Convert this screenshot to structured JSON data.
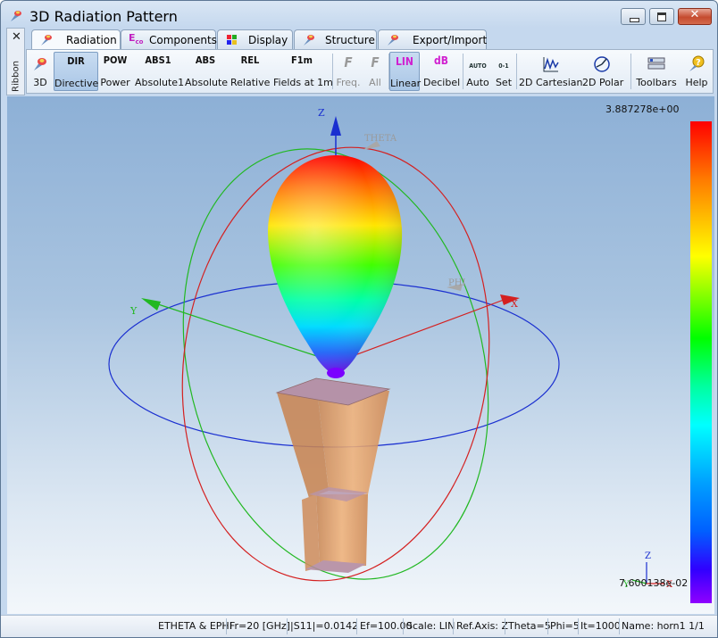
{
  "window": {
    "title": "3D Radiation Pattern"
  },
  "ribbon": {
    "close_glyph": "✕",
    "side_label": "Ribbon"
  },
  "tabs": [
    {
      "label": "Radiation",
      "icon": "radiation-tab-icon"
    },
    {
      "label": "Components",
      "icon": "eco-components-icon"
    },
    {
      "label": "Display",
      "icon": "display-tab-icon"
    },
    {
      "label": "Structure",
      "icon": "structure-tab-icon"
    },
    {
      "label": "Export/Import",
      "icon": "export-import-icon"
    }
  ],
  "toolbar": {
    "btn_3d": {
      "label": "3D"
    },
    "btn_directive": {
      "icon": "DIR",
      "label": "Directive"
    },
    "btn_power": {
      "icon": "POW",
      "label": "Power"
    },
    "btn_absolute1": {
      "icon": "ABS1",
      "label": "Absolute1"
    },
    "btn_absolute": {
      "icon": "ABS",
      "label": "Absolute"
    },
    "btn_relative": {
      "icon": "REL",
      "label": "Relative"
    },
    "btn_fields": {
      "icon": "F1m",
      "label": "Fields at 1m"
    },
    "btn_freq": {
      "icon": "F",
      "label": "Freq."
    },
    "btn_all": {
      "icon": "F",
      "label": "All"
    },
    "btn_linear": {
      "icon": "LIN",
      "label": "Linear"
    },
    "btn_decibel": {
      "icon": "dB",
      "label": "Decibel"
    },
    "btn_auto": {
      "icon": "AUTO",
      "label": "Auto"
    },
    "btn_set": {
      "icon": "0-1",
      "label": "Set"
    },
    "btn_2d_cartesian": {
      "label": "2D Cartesian"
    },
    "btn_2d_polar": {
      "label": "2D Polar"
    },
    "btn_toolbars": {
      "label": "Toolbars"
    },
    "btn_help": {
      "label": "Help"
    }
  },
  "viewport": {
    "scale_max": "3.887278e+00",
    "scale_min": "7.600138e-02",
    "axis_labels": {
      "z": "Z",
      "x": "X",
      "y": "Y",
      "theta": "THETA",
      "phi": "PHI"
    },
    "mini_axis": {
      "z": "Z",
      "x": "X",
      "y": "Y"
    },
    "colors": {
      "theta_circle": "#d42020",
      "phi_circle": "#22b822",
      "equator_circle": "#1a2fd0",
      "horn": "#e8a060"
    }
  },
  "status": {
    "field": "ETHETA & EPHI",
    "frequency": "Fr=20 [GHz]",
    "s11": "|S11|=0.0142",
    "ef": "Ef=100.00",
    "scale": "Scale: LIN",
    "ref_axis": "Ref.Axis: Z",
    "theta": "Theta=5",
    "phi": "Phi=5",
    "iterations": "It=1000",
    "name": "Name: horn1 1/1"
  }
}
